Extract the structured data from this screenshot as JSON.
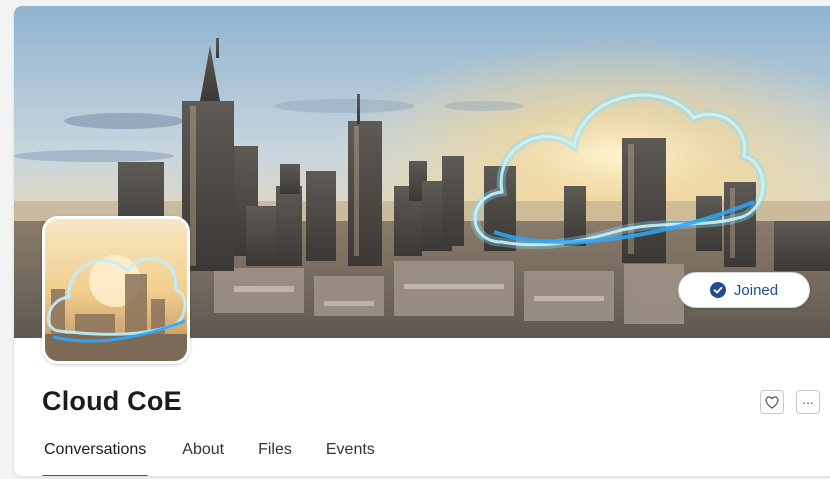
{
  "group": {
    "title": "Cloud CoE",
    "membership_status": "Joined",
    "status_icon": "check-circle-icon",
    "accent_color": "#0f6cbd",
    "banner_image": "frankfurt-skyline-cloud",
    "avatar_image": "cloud-skyline-avatar"
  },
  "actions": {
    "like_icon": "heart-icon",
    "more_icon": "more-options-icon",
    "more_glyph": "..."
  },
  "tabs": [
    {
      "label": "Conversations",
      "active": true
    },
    {
      "label": "About",
      "active": false
    },
    {
      "label": "Files",
      "active": false
    },
    {
      "label": "Events",
      "active": false
    }
  ]
}
